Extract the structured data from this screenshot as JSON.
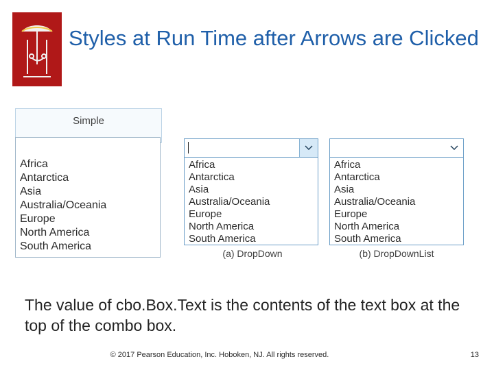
{
  "slide": {
    "title": "Styles at Run Time after Arrows are Clicked",
    "body_text": "The value of cbo.Box.Text is the contents of the text box at the top of the combo box.",
    "footer": {
      "copyright": "© 2017 Pearson Education, Inc. Hoboken, NJ. All rights reserved.",
      "page_number": "13"
    }
  },
  "figure": {
    "simple": {
      "label": "Simple",
      "textbox_value": "",
      "items": [
        "Africa",
        "Antarctica",
        "Asia",
        "Australia/Oceania",
        "Europe",
        "North America",
        "South America"
      ]
    },
    "dropdown": {
      "caption": "(a) DropDown",
      "textbox_value": "",
      "items": [
        "Africa",
        "Antarctica",
        "Asia",
        "Australia/Oceania",
        "Europe",
        "North America",
        "South America"
      ]
    },
    "dropdownlist": {
      "caption": "(b) DropDownList",
      "selected_value": "",
      "items": [
        "Africa",
        "Antarctica",
        "Asia",
        "Australia/Oceania",
        "Europe",
        "North America",
        "South America"
      ]
    }
  },
  "colors": {
    "title": "#1f5fa9",
    "logo_background": "#b01818",
    "combo_border": "#6b9ec7",
    "caret_fill": "#d6e9f7"
  }
}
